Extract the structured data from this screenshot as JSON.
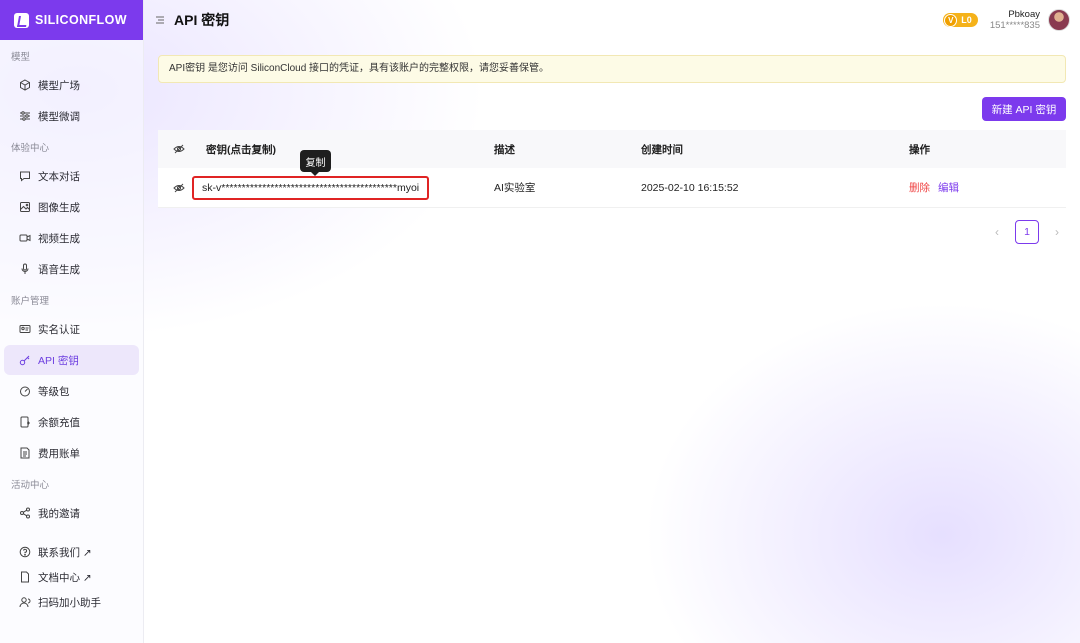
{
  "brand": {
    "name": "SILICONFLOW",
    "color": "#7c3aed"
  },
  "header": {
    "title": "API 密钥",
    "level": {
      "letter": "V",
      "label": "L0"
    },
    "user": {
      "name": "Pbkoay",
      "phone": "151*****835"
    }
  },
  "sidebar": {
    "sections": [
      {
        "title": "模型",
        "items": [
          {
            "label": "模型广场",
            "icon": "cube-icon"
          },
          {
            "label": "模型微调",
            "icon": "sliders-icon"
          }
        ]
      },
      {
        "title": "体验中心",
        "items": [
          {
            "label": "文本对话",
            "icon": "chat-icon"
          },
          {
            "label": "图像生成",
            "icon": "image-icon"
          },
          {
            "label": "视频生成",
            "icon": "video-icon"
          },
          {
            "label": "语音生成",
            "icon": "microphone-icon"
          }
        ]
      },
      {
        "title": "账户管理",
        "items": [
          {
            "label": "实名认证",
            "icon": "id-card-icon"
          },
          {
            "label": "API 密钥",
            "icon": "key-icon",
            "active": true
          },
          {
            "label": "等级包",
            "icon": "gauge-icon"
          },
          {
            "label": "余额充值",
            "icon": "recharge-icon"
          },
          {
            "label": "费用账单",
            "icon": "bill-icon"
          }
        ]
      },
      {
        "title": "活动中心",
        "items": [
          {
            "label": "我的邀请",
            "icon": "share-icon"
          }
        ]
      }
    ],
    "footer": [
      {
        "label": "联系我们 ↗",
        "icon": "help-icon"
      },
      {
        "label": "文档中心 ↗",
        "icon": "document-icon"
      },
      {
        "label": "扫码加小助手",
        "icon": "user-icon"
      }
    ]
  },
  "notice": "API密钥 是您访问 SiliconCloud 接口的凭证，具有该账户的完整权限，请您妥善保管。",
  "actions": {
    "new_key": "新建 API 密钥"
  },
  "table": {
    "columns": [
      "密钥(点击复制)",
      "描述",
      "创建时间",
      "操作"
    ],
    "rows": [
      {
        "key": "sk-v*******************************************myoi",
        "description": "AI实验室",
        "created": "2025-02-10 16:15:52",
        "delete": "删除",
        "edit": "编辑"
      }
    ]
  },
  "tooltip": "复制",
  "pagination": {
    "current": "1"
  }
}
